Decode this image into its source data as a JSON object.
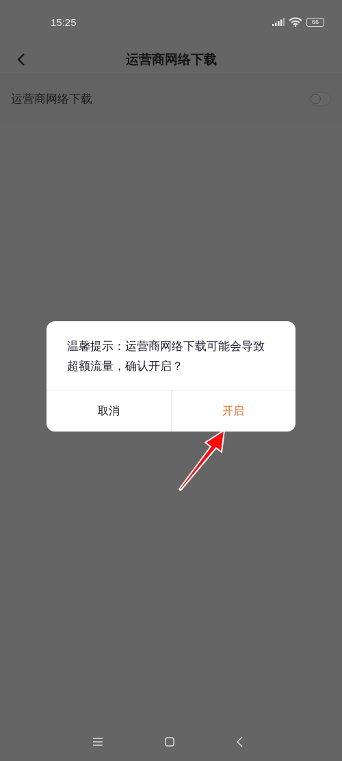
{
  "status_bar": {
    "time": "15:25",
    "battery": "66"
  },
  "header": {
    "title": "运营商网络下载"
  },
  "settings": [
    {
      "label": "运营商网络下载",
      "on": false
    }
  ],
  "dialog": {
    "message": "温馨提示：运营商网络下载可能会导致超额流量，确认开启？",
    "buttons": [
      {
        "label": "取消",
        "kind": "cancel"
      },
      {
        "label": "开启",
        "kind": "confirm"
      }
    ]
  },
  "nav_bar": {
    "buttons": [
      {
        "kind": "menu"
      },
      {
        "kind": "home"
      },
      {
        "kind": "back"
      }
    ]
  }
}
